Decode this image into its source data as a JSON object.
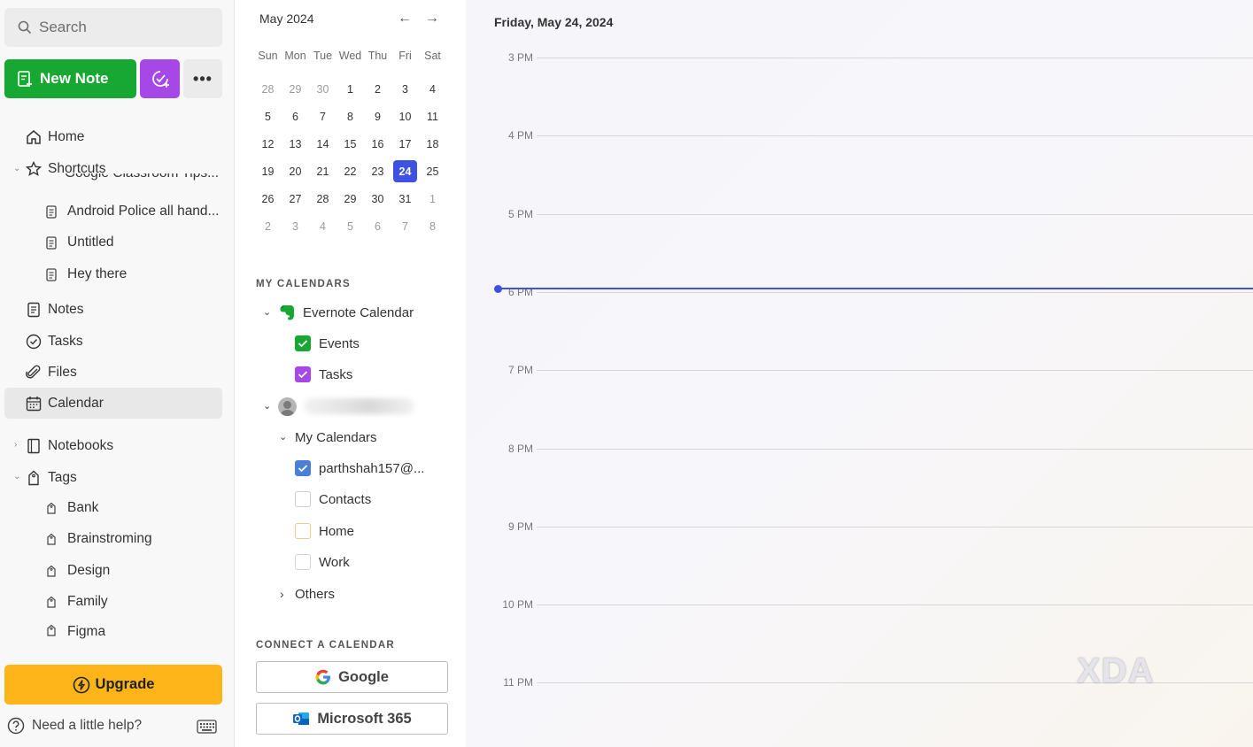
{
  "sidebar": {
    "search_placeholder": "Search",
    "new_note_label": "New Note",
    "nav": {
      "home": "Home",
      "shortcuts": "Shortcuts",
      "notes": "Notes",
      "tasks": "Tasks",
      "files": "Files",
      "calendar": "Calendar",
      "notebooks": "Notebooks",
      "tags": "Tags"
    },
    "shortcuts": {
      "clipped": "Google Classroom Tips...",
      "items": [
        "Android Police all hand...",
        "Untitled",
        "Hey there"
      ]
    },
    "tags": [
      "Bank",
      "Brainstroming",
      "Design",
      "Family",
      "Figma"
    ],
    "upgrade_label": "Upgrade",
    "help_label": "Need a little help?"
  },
  "mini_calendar": {
    "month_label": "May 2024",
    "weekdays": [
      "Sun",
      "Mon",
      "Tue",
      "Wed",
      "Thu",
      "Fri",
      "Sat"
    ],
    "weeks": [
      [
        "28",
        "29",
        "30",
        "1",
        "2",
        "3",
        "4"
      ],
      [
        "5",
        "6",
        "7",
        "8",
        "9",
        "10",
        "11"
      ],
      [
        "12",
        "13",
        "14",
        "15",
        "16",
        "17",
        "18"
      ],
      [
        "19",
        "20",
        "21",
        "22",
        "23",
        "24",
        "25"
      ],
      [
        "26",
        "27",
        "28",
        "29",
        "30",
        "31",
        "1"
      ],
      [
        "2",
        "3",
        "4",
        "5",
        "6",
        "7",
        "8"
      ]
    ],
    "selected_day": "24"
  },
  "my_calendars": {
    "heading": "MY CALENDARS",
    "evernote_label": "Evernote Calendar",
    "events_label": "Events",
    "tasks_label": "Tasks",
    "group_label": "My Calendars",
    "account_calendar_label": "parthshah157@...",
    "contacts_label": "Contacts",
    "home_label": "Home",
    "work_label": "Work",
    "others_label": "Others",
    "colors": {
      "events": "#16a832",
      "tasks": "#a647e8",
      "account": "#4a7fd9",
      "home": "#f3c98a"
    }
  },
  "connect": {
    "heading": "CONNECT A CALENDAR",
    "google_label": "Google",
    "microsoft_label": "Microsoft 365"
  },
  "day_view": {
    "date_label": "Friday, May 24, 2024",
    "hours": [
      "3 PM",
      "4 PM",
      "5 PM",
      "6 PM",
      "7 PM",
      "8 PM",
      "9 PM",
      "10 PM",
      "11 PM"
    ],
    "watermark": "XDA"
  }
}
